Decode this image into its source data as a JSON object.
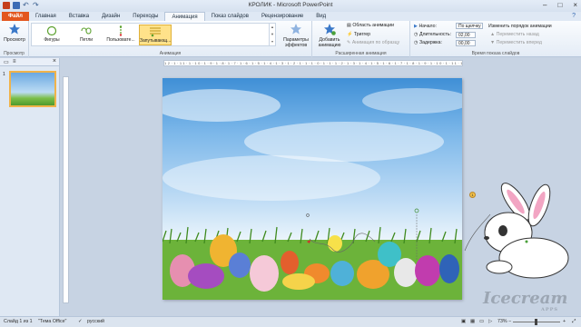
{
  "window": {
    "title": "КРОЛИК - Microsoft PowerPoint"
  },
  "tabs": [
    {
      "label": "Файл"
    },
    {
      "label": "Главная"
    },
    {
      "label": "Вставка"
    },
    {
      "label": "Дизайн"
    },
    {
      "label": "Переходы"
    },
    {
      "label": "Анимация"
    },
    {
      "label": "Показ слайдов"
    },
    {
      "label": "Рецензирование"
    },
    {
      "label": "Вид"
    }
  ],
  "ribbon": {
    "preview": {
      "button": "Просмотр",
      "group": "Просмотр"
    },
    "animation": {
      "group": "Анимация",
      "gallery": [
        {
          "label": "Фигуры"
        },
        {
          "label": "Петли"
        },
        {
          "label": "Пользовате..."
        },
        {
          "label": "Запутывающ..."
        }
      ],
      "effects": "Параметры эффектов"
    },
    "advanced": {
      "group": "Расширенная анимация",
      "add": "Добавить анимацию",
      "pane": "Область анимации",
      "trigger": "Триггер",
      "painter": "Анимация по образцу"
    },
    "timing": {
      "group": "Время показа слайдов",
      "start_label": "Начало:",
      "start_value": "По щелчку",
      "duration_label": "Длительность:",
      "duration_value": "02,00",
      "delay_label": "Задержка:",
      "delay_value": "00,00",
      "reorder": "Изменить порядок анимации",
      "earlier": "Переместить назад",
      "later": "Переместить вперед"
    }
  },
  "ruler": {
    "text": "12·1·11·1·10·1·9·1·8·1·7·1·6·1·5·1·4·1·3·1·2·1·1·1·0·1·1·1·2·1·3·1·4·1·5·1·6·1·7·1·8·1·9·1·10·1·11·1·12"
  },
  "leftpane": {
    "slide_number": "1"
  },
  "status": {
    "slide": "Слайд 1 из 1",
    "theme": "\"Тема Office\"",
    "language": "русский",
    "zoom": "73%"
  },
  "watermark": {
    "brand": "Icecream",
    "sub": "APPS"
  }
}
